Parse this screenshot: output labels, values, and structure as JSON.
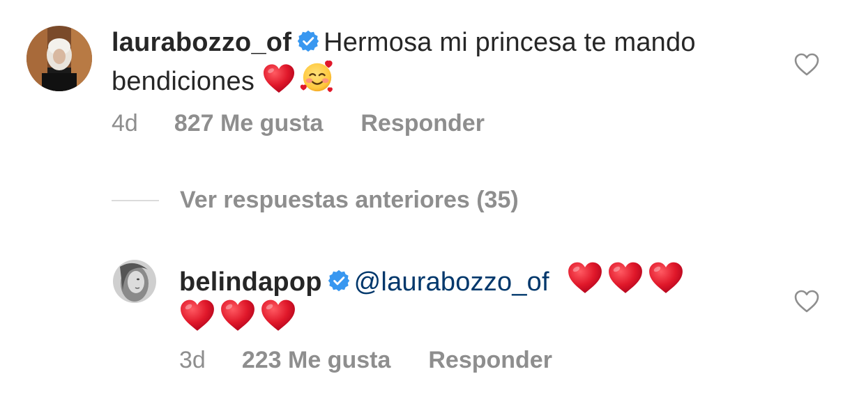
{
  "comments": [
    {
      "username": "laurabozzo_of",
      "verified": true,
      "text": "Hermosa mi princesa te mando bendiciones",
      "emojis": [
        "red-heart",
        "smiling-face-with-hearts"
      ],
      "time": "4d",
      "likes": "827 Me gusta",
      "reply_label": "Responder"
    },
    {
      "username": "belindapop",
      "verified": true,
      "mention": "@laurabozzo_of",
      "emojis": [
        "red-heart",
        "red-heart",
        "red-heart",
        "red-heart",
        "red-heart",
        "red-heart"
      ],
      "time": "3d",
      "likes": "223 Me gusta",
      "reply_label": "Responder"
    }
  ],
  "view_replies_label": "Ver respuestas anteriores (35)",
  "colors": {
    "text": "#262626",
    "secondary": "#8e8e8e",
    "mention": "#00376b",
    "verified": "#3897f0",
    "heart_red": "#e0182a"
  }
}
